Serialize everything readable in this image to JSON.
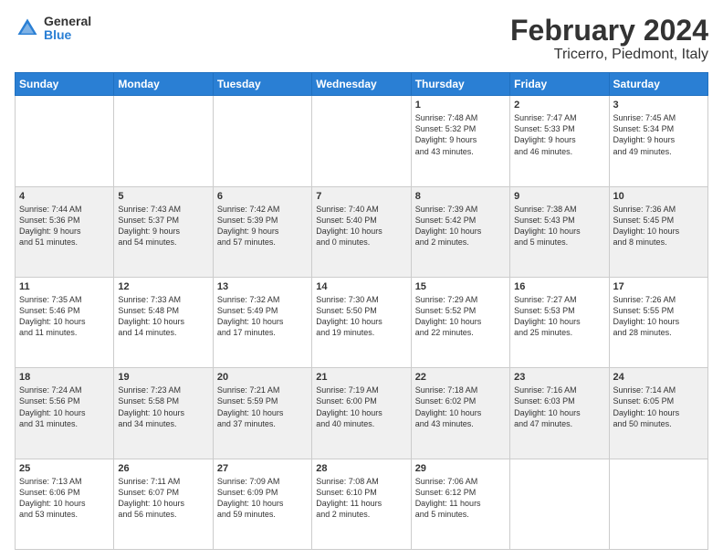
{
  "logo": {
    "general": "General",
    "blue": "Blue"
  },
  "title": "February 2024",
  "subtitle": "Tricerro, Piedmont, Italy",
  "days_of_week": [
    "Sunday",
    "Monday",
    "Tuesday",
    "Wednesday",
    "Thursday",
    "Friday",
    "Saturday"
  ],
  "weeks": [
    [
      {
        "day": "",
        "info": ""
      },
      {
        "day": "",
        "info": ""
      },
      {
        "day": "",
        "info": ""
      },
      {
        "day": "",
        "info": ""
      },
      {
        "day": "1",
        "info": "Sunrise: 7:48 AM\nSunset: 5:32 PM\nDaylight: 9 hours\nand 43 minutes."
      },
      {
        "day": "2",
        "info": "Sunrise: 7:47 AM\nSunset: 5:33 PM\nDaylight: 9 hours\nand 46 minutes."
      },
      {
        "day": "3",
        "info": "Sunrise: 7:45 AM\nSunset: 5:34 PM\nDaylight: 9 hours\nand 49 minutes."
      }
    ],
    [
      {
        "day": "4",
        "info": "Sunrise: 7:44 AM\nSunset: 5:36 PM\nDaylight: 9 hours\nand 51 minutes."
      },
      {
        "day": "5",
        "info": "Sunrise: 7:43 AM\nSunset: 5:37 PM\nDaylight: 9 hours\nand 54 minutes."
      },
      {
        "day": "6",
        "info": "Sunrise: 7:42 AM\nSunset: 5:39 PM\nDaylight: 9 hours\nand 57 minutes."
      },
      {
        "day": "7",
        "info": "Sunrise: 7:40 AM\nSunset: 5:40 PM\nDaylight: 10 hours\nand 0 minutes."
      },
      {
        "day": "8",
        "info": "Sunrise: 7:39 AM\nSunset: 5:42 PM\nDaylight: 10 hours\nand 2 minutes."
      },
      {
        "day": "9",
        "info": "Sunrise: 7:38 AM\nSunset: 5:43 PM\nDaylight: 10 hours\nand 5 minutes."
      },
      {
        "day": "10",
        "info": "Sunrise: 7:36 AM\nSunset: 5:45 PM\nDaylight: 10 hours\nand 8 minutes."
      }
    ],
    [
      {
        "day": "11",
        "info": "Sunrise: 7:35 AM\nSunset: 5:46 PM\nDaylight: 10 hours\nand 11 minutes."
      },
      {
        "day": "12",
        "info": "Sunrise: 7:33 AM\nSunset: 5:48 PM\nDaylight: 10 hours\nand 14 minutes."
      },
      {
        "day": "13",
        "info": "Sunrise: 7:32 AM\nSunset: 5:49 PM\nDaylight: 10 hours\nand 17 minutes."
      },
      {
        "day": "14",
        "info": "Sunrise: 7:30 AM\nSunset: 5:50 PM\nDaylight: 10 hours\nand 19 minutes."
      },
      {
        "day": "15",
        "info": "Sunrise: 7:29 AM\nSunset: 5:52 PM\nDaylight: 10 hours\nand 22 minutes."
      },
      {
        "day": "16",
        "info": "Sunrise: 7:27 AM\nSunset: 5:53 PM\nDaylight: 10 hours\nand 25 minutes."
      },
      {
        "day": "17",
        "info": "Sunrise: 7:26 AM\nSunset: 5:55 PM\nDaylight: 10 hours\nand 28 minutes."
      }
    ],
    [
      {
        "day": "18",
        "info": "Sunrise: 7:24 AM\nSunset: 5:56 PM\nDaylight: 10 hours\nand 31 minutes."
      },
      {
        "day": "19",
        "info": "Sunrise: 7:23 AM\nSunset: 5:58 PM\nDaylight: 10 hours\nand 34 minutes."
      },
      {
        "day": "20",
        "info": "Sunrise: 7:21 AM\nSunset: 5:59 PM\nDaylight: 10 hours\nand 37 minutes."
      },
      {
        "day": "21",
        "info": "Sunrise: 7:19 AM\nSunset: 6:00 PM\nDaylight: 10 hours\nand 40 minutes."
      },
      {
        "day": "22",
        "info": "Sunrise: 7:18 AM\nSunset: 6:02 PM\nDaylight: 10 hours\nand 43 minutes."
      },
      {
        "day": "23",
        "info": "Sunrise: 7:16 AM\nSunset: 6:03 PM\nDaylight: 10 hours\nand 47 minutes."
      },
      {
        "day": "24",
        "info": "Sunrise: 7:14 AM\nSunset: 6:05 PM\nDaylight: 10 hours\nand 50 minutes."
      }
    ],
    [
      {
        "day": "25",
        "info": "Sunrise: 7:13 AM\nSunset: 6:06 PM\nDaylight: 10 hours\nand 53 minutes."
      },
      {
        "day": "26",
        "info": "Sunrise: 7:11 AM\nSunset: 6:07 PM\nDaylight: 10 hours\nand 56 minutes."
      },
      {
        "day": "27",
        "info": "Sunrise: 7:09 AM\nSunset: 6:09 PM\nDaylight: 10 hours\nand 59 minutes."
      },
      {
        "day": "28",
        "info": "Sunrise: 7:08 AM\nSunset: 6:10 PM\nDaylight: 11 hours\nand 2 minutes."
      },
      {
        "day": "29",
        "info": "Sunrise: 7:06 AM\nSunset: 6:12 PM\nDaylight: 11 hours\nand 5 minutes."
      },
      {
        "day": "",
        "info": ""
      },
      {
        "day": "",
        "info": ""
      }
    ]
  ]
}
